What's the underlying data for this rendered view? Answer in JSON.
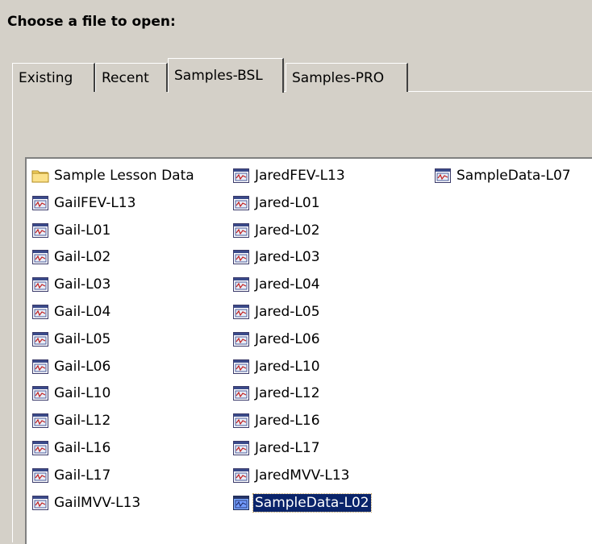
{
  "dialog": {
    "prompt": "Choose a file to open:"
  },
  "tabs": [
    {
      "label": "Existing",
      "active": false
    },
    {
      "label": "Recent",
      "active": false
    },
    {
      "label": "Samples-BSL",
      "active": true
    },
    {
      "label": "Samples-PRO",
      "active": false
    }
  ],
  "files": {
    "col1": [
      {
        "name": "Sample Lesson Data",
        "icon": "folder-icon"
      },
      {
        "name": "GailFEV-L13",
        "icon": "data-file-icon"
      },
      {
        "name": "Gail-L01",
        "icon": "data-file-icon"
      },
      {
        "name": "Gail-L02",
        "icon": "data-file-icon"
      },
      {
        "name": "Gail-L03",
        "icon": "data-file-icon"
      },
      {
        "name": "Gail-L04",
        "icon": "data-file-icon"
      },
      {
        "name": "Gail-L05",
        "icon": "data-file-icon"
      },
      {
        "name": "Gail-L06",
        "icon": "data-file-icon"
      },
      {
        "name": "Gail-L10",
        "icon": "data-file-icon"
      },
      {
        "name": "Gail-L12",
        "icon": "data-file-icon"
      },
      {
        "name": "Gail-L16",
        "icon": "data-file-icon"
      },
      {
        "name": "Gail-L17",
        "icon": "data-file-icon"
      },
      {
        "name": "GailMVV-L13",
        "icon": "data-file-icon"
      }
    ],
    "col2": [
      {
        "name": "JaredFEV-L13",
        "icon": "data-file-icon"
      },
      {
        "name": "Jared-L01",
        "icon": "data-file-icon"
      },
      {
        "name": "Jared-L02",
        "icon": "data-file-icon"
      },
      {
        "name": "Jared-L03",
        "icon": "data-file-icon"
      },
      {
        "name": "Jared-L04",
        "icon": "data-file-icon"
      },
      {
        "name": "Jared-L05",
        "icon": "data-file-icon"
      },
      {
        "name": "Jared-L06",
        "icon": "data-file-icon"
      },
      {
        "name": "Jared-L10",
        "icon": "data-file-icon"
      },
      {
        "name": "Jared-L12",
        "icon": "data-file-icon"
      },
      {
        "name": "Jared-L16",
        "icon": "data-file-icon"
      },
      {
        "name": "Jared-L17",
        "icon": "data-file-icon"
      },
      {
        "name": "JaredMVV-L13",
        "icon": "data-file-icon"
      },
      {
        "name": "SampleData-L02",
        "icon": "data-file-icon",
        "selected": true
      }
    ],
    "col3": [
      {
        "name": "SampleData-L07",
        "icon": "data-file-icon"
      }
    ]
  },
  "colors": {
    "dialog_bg": "#d4d0c8",
    "selection_bg": "#0a246a",
    "list_bg": "#ffffff"
  }
}
